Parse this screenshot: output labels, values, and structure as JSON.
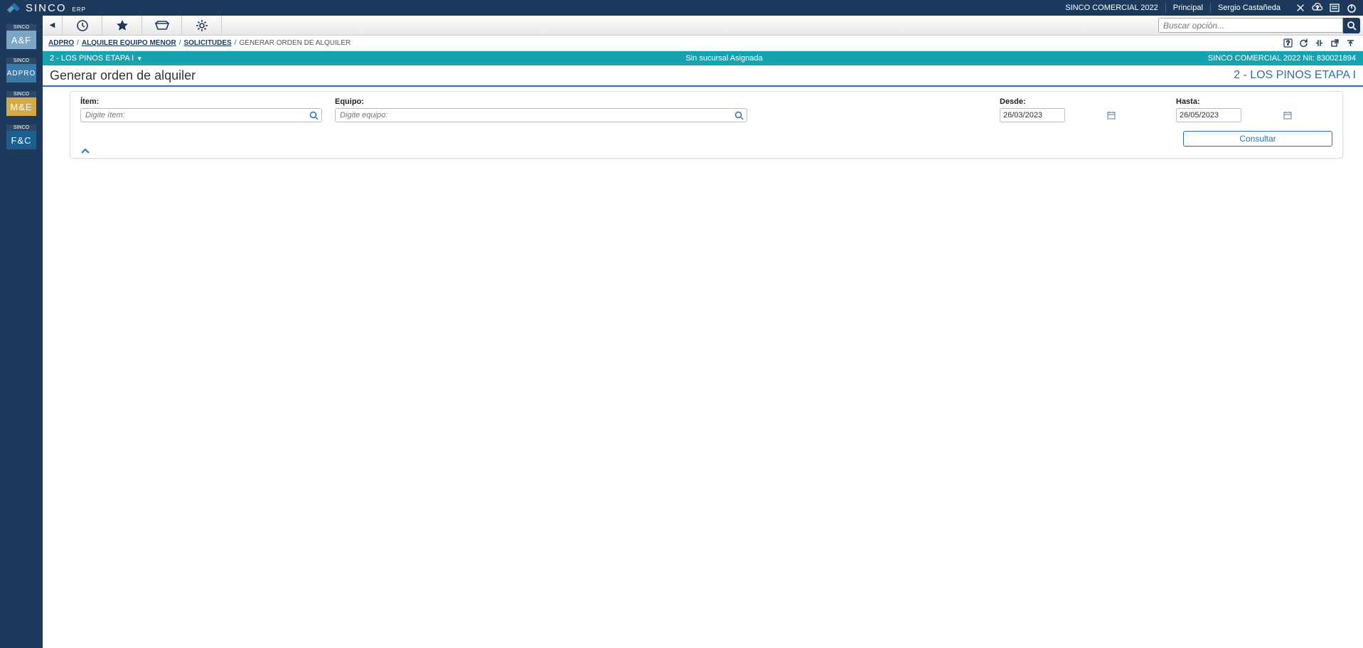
{
  "header": {
    "brand_main": "SINCO",
    "brand_sub": "ERP",
    "company": "SINCO COMERCIAL 2022",
    "role": "Principal",
    "user": "Sergio Castañeda"
  },
  "sidebar": {
    "items": [
      {
        "sup": "SINCO",
        "label": "A&F",
        "cls": "mod-af"
      },
      {
        "sup": "SINCO",
        "label": "ADPRO",
        "cls": "mod-adp"
      },
      {
        "sup": "SINCO",
        "label": "M&E",
        "cls": "mod-me"
      },
      {
        "sup": "SINCO",
        "label": "F&C",
        "cls": "mod-fc"
      }
    ]
  },
  "toolbar": {
    "search_placeholder": "Buscar opción..."
  },
  "breadcrumb": {
    "items": [
      "ADPRO",
      "ALQUILER EQUIPO MENOR",
      "SOLICITUDES",
      "GENERAR ORDEN DE ALQUILER"
    ]
  },
  "tealbar": {
    "left": "2 - LOS PINOS ETAPA I",
    "center": "Sin sucursal Asignada",
    "right": "SINCO COMERCIAL 2022 Nit: 830021894"
  },
  "page": {
    "title": "Generar orden de alquiler",
    "context": "2 - LOS PINOS ETAPA I"
  },
  "filters": {
    "item_label": "Ítem:",
    "item_placeholder": "Digite ítem:",
    "equipo_label": "Equipo:",
    "equipo_placeholder": "Digite equipo:",
    "desde_label": "Desde:",
    "desde_value": "26/03/2023",
    "hasta_label": "Hasta:",
    "hasta_value": "26/05/2023",
    "consultar": "Consultar"
  }
}
